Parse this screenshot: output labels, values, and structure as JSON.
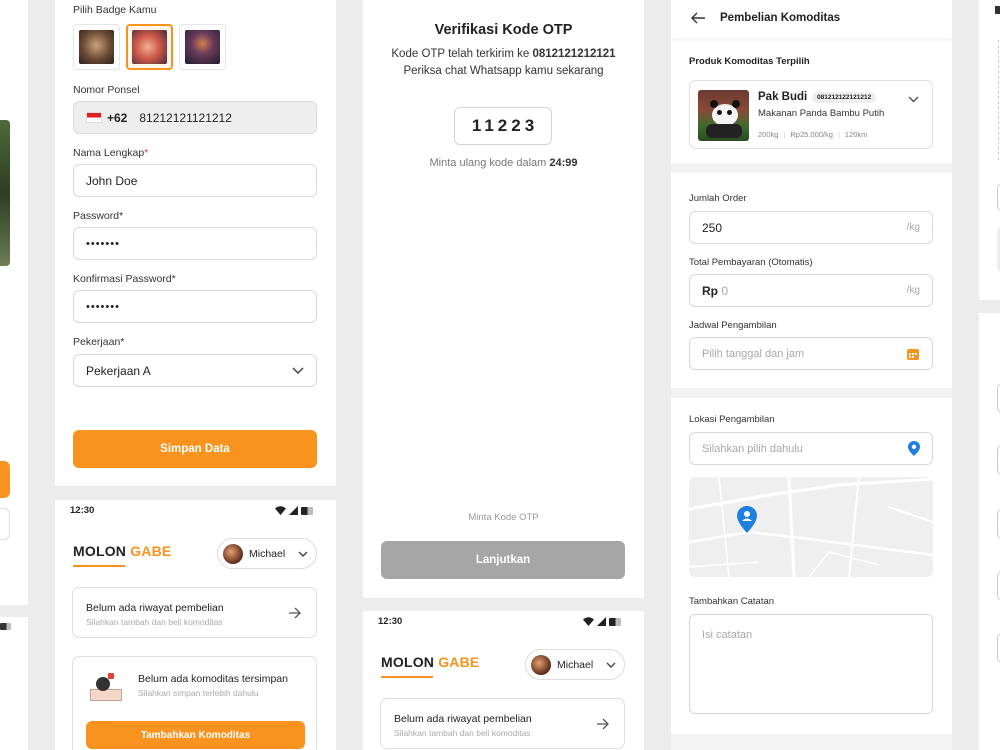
{
  "register": {
    "badge_label": "Pilih Badge Kamu",
    "phone_label": "Nomor Ponsel",
    "phone_code": "+62",
    "phone_value": "81212121121212",
    "name_label": "Nama Lengkap",
    "name_required": "*",
    "name_value": "John Doe",
    "password_label": "Password*",
    "password_value": "•••••••",
    "confirm_label": "Konfirmasi Password*",
    "confirm_value": "•••••••",
    "job_label": "Pekerjaan*",
    "job_value": "Pekerjaan A",
    "save_button": "Simpan Data"
  },
  "home": {
    "time": "12:30",
    "logo_a": "MOLON",
    "logo_b": "GABE",
    "user_name": "Michael",
    "history_title": "Belum ada riwayat pembelian",
    "history_sub": "Silahkan tambah dan beli komoditas",
    "saved_title": "Belum ada komoditas tersimpan",
    "saved_sub": "Silahkan simpan terlebih dahulu",
    "add_button": "Tambahkan Komoditas"
  },
  "otp": {
    "title": "Verifikasi Kode OTP",
    "line1_prefix": "Kode OTP telah terkirim ke ",
    "line1_number": "0812121212121",
    "line2": "Periksa chat Whatsapp kamu sekarang",
    "code": "11223",
    "resend_prefix": "Minta ulang kode dalam ",
    "resend_timer": "24:99",
    "request_link": "Minta Kode OTP",
    "continue_button": "Lanjutkan"
  },
  "purchase": {
    "header_title": "Pembelian Komoditas",
    "selected_label": "Produk Komoditas Terpilih",
    "seller_name": "Pak Budi",
    "seller_phone": "081212122121212",
    "product_name": "Makanan Panda Bambu Putih",
    "stat_weight": "200kg",
    "stat_price": "Rp25.000/kg",
    "stat_distance": "120km",
    "order_label": "Jumlah Order",
    "order_value": "250",
    "order_unit": "/kg",
    "total_label": "Total Pembayaran (Otomatis)",
    "total_prefix": "Rp",
    "total_value": "0",
    "total_unit": "/kg",
    "schedule_label": "Jadwal Pengambilan",
    "schedule_placeholder": "Pilih tanggal dan jam",
    "location_label": "Lokasi Pengambilan",
    "location_placeholder": "Silahkan pilih dahulu",
    "notes_label": "Tambahkan Catatan",
    "notes_placeholder": "Isi catatan"
  },
  "colors": {
    "accent": "#f7931e",
    "disabled": "#a6a6a6",
    "map_pin": "#1e7fe0"
  }
}
